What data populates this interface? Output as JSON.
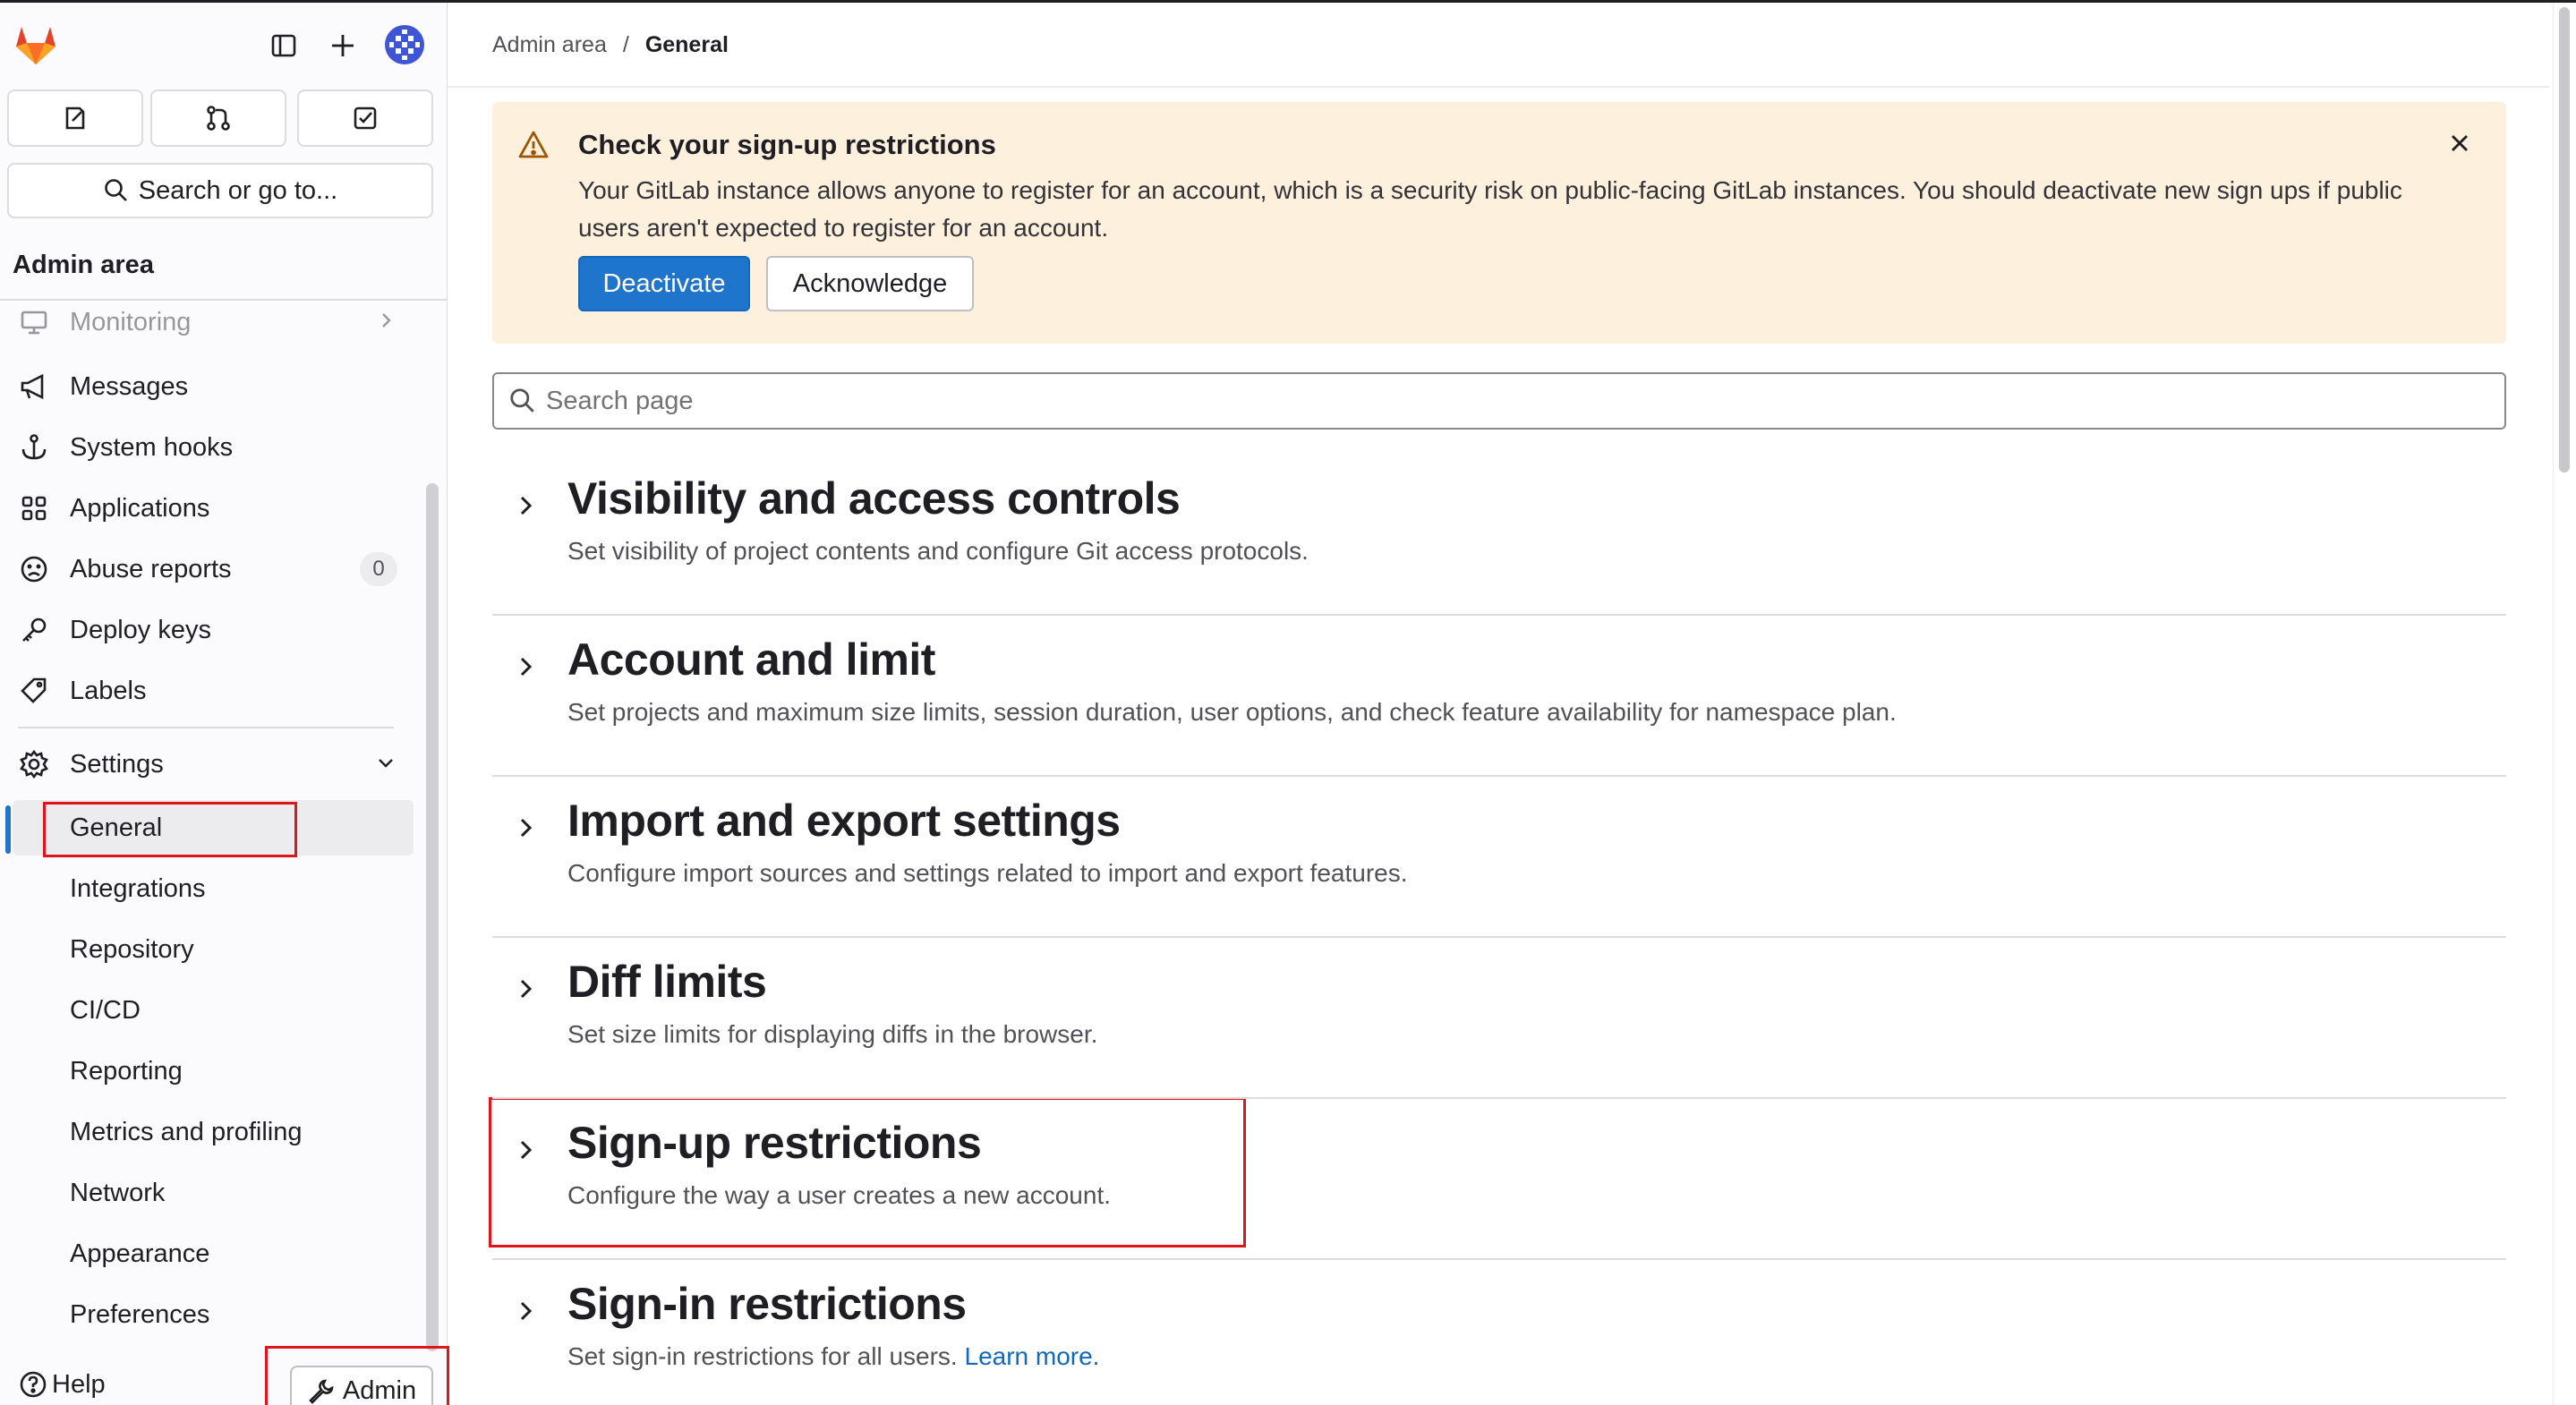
{
  "sidebar": {
    "search_label": "Search or go to...",
    "section_title": "Admin area",
    "items": [
      {
        "label": "Monitoring",
        "icon": "monitor-icon"
      },
      {
        "label": "Messages",
        "icon": "megaphone-icon"
      },
      {
        "label": "System hooks",
        "icon": "anchor-icon"
      },
      {
        "label": "Applications",
        "icon": "applications-icon"
      },
      {
        "label": "Abuse reports",
        "icon": "abuse-icon",
        "badge": "0"
      },
      {
        "label": "Deploy keys",
        "icon": "key-icon"
      },
      {
        "label": "Labels",
        "icon": "label-icon"
      },
      {
        "label": "Settings",
        "icon": "settings-icon"
      }
    ],
    "settings_sub": [
      "General",
      "Integrations",
      "Repository",
      "CI/CD",
      "Reporting",
      "Metrics and profiling",
      "Network",
      "Appearance",
      "Preferences"
    ],
    "help_label": "Help",
    "admin_label": "Admin"
  },
  "breadcrumb": {
    "root": "Admin area",
    "separator": "/",
    "current": "General"
  },
  "alert": {
    "title": "Check your sign-up restrictions",
    "body": "Your GitLab instance allows anyone to register for an account, which is a security risk on public-facing GitLab instances. You should deactivate new sign ups if public users aren't expected to register for an account.",
    "primary_label": "Deactivate",
    "secondary_label": "Acknowledge"
  },
  "page_search": {
    "placeholder": "Search page"
  },
  "sections": [
    {
      "title": "Visibility and access controls",
      "desc": "Set visibility of project contents and configure Git access protocols."
    },
    {
      "title": "Account and limit",
      "desc": "Set projects and maximum size limits, session duration, user options, and check feature availability for namespace plan."
    },
    {
      "title": "Import and export settings",
      "desc": "Configure import sources and settings related to import and export features."
    },
    {
      "title": "Diff limits",
      "desc": "Set size limits for displaying diffs in the browser."
    },
    {
      "title": "Sign-up restrictions",
      "desc": "Configure the way a user creates a new account."
    },
    {
      "title": "Sign-in restrictions",
      "desc": "Set sign-in restrictions for all users.",
      "link": "Learn more."
    }
  ],
  "colors": {
    "accent": "#1f75cb",
    "alert_bg": "#fdf1dd",
    "highlight": "#e0151b"
  }
}
